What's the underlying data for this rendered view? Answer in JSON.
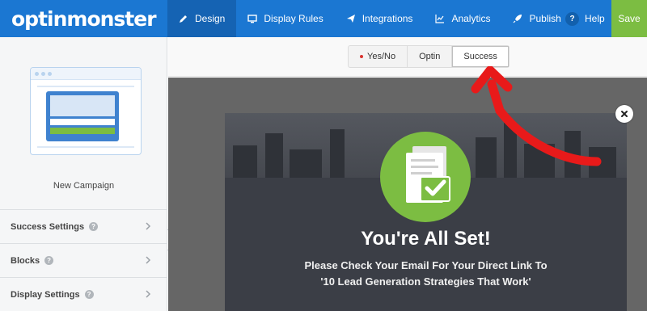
{
  "brand": {
    "logo_text": "optinmonster"
  },
  "nav": {
    "items": [
      {
        "label": "Design",
        "icon": "pencil-icon"
      },
      {
        "label": "Display Rules",
        "icon": "monitor-icon"
      },
      {
        "label": "Integrations",
        "icon": "paper-plane-icon"
      },
      {
        "label": "Analytics",
        "icon": "chart-line-icon"
      },
      {
        "label": "Publish",
        "icon": "rocket-icon"
      }
    ],
    "help_label": "Help",
    "help_icon_text": "?",
    "save_label": "Save"
  },
  "sidebar": {
    "campaign_name": "New Campaign",
    "sections": [
      {
        "label": "Success Settings"
      },
      {
        "label": "Blocks"
      },
      {
        "label": "Display Settings"
      }
    ],
    "help_icon_text": "?"
  },
  "tabs": [
    {
      "label": "Yes/No"
    },
    {
      "label": "Optin"
    },
    {
      "label": "Success"
    }
  ],
  "popup": {
    "title": "You're All Set!",
    "subtitle_line1": "Please Check Your Email For Your Direct Link To",
    "subtitle_line2": "'10 Lead Generation Strategies That Work'"
  },
  "colors": {
    "nav_blue": "#1b77d2",
    "save_green": "#7cbd42",
    "annotation_red": "#e81a1a"
  }
}
